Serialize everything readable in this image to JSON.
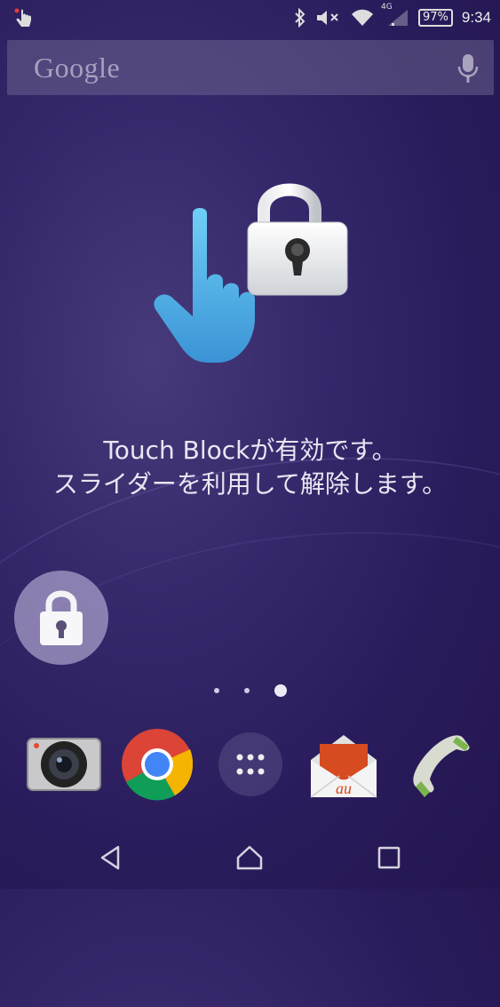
{
  "status_bar": {
    "battery": "97%",
    "time": "9:34",
    "network": "4G",
    "icons": [
      "touch-block-notification-icon",
      "bluetooth-icon",
      "mute-icon",
      "wifi-icon",
      "signal-icon",
      "battery-icon"
    ]
  },
  "search": {
    "logo_text": "Google",
    "icon": "mic-icon"
  },
  "overlay": {
    "line1": "Touch Blockが有効です。",
    "line2": "スライダーを利用して解除します。"
  },
  "page_indicator": {
    "count": 3,
    "active_index": 2
  },
  "dock": {
    "apps": [
      "camera",
      "chrome",
      "app-drawer",
      "au-mail",
      "phone"
    ],
    "mail_label": "au"
  },
  "navigation": [
    "back",
    "home",
    "recents"
  ]
}
